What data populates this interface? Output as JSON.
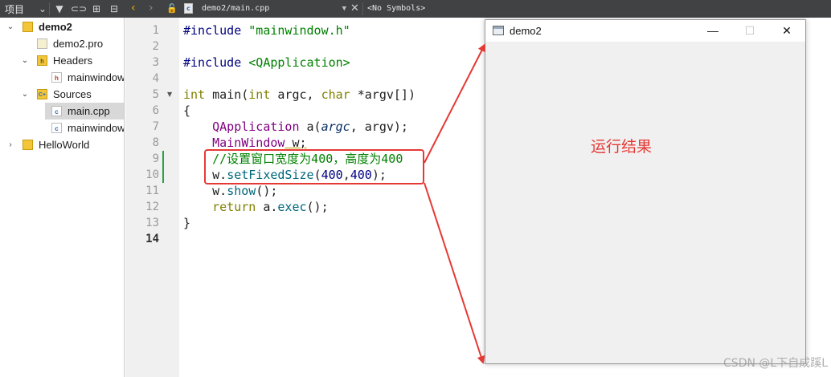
{
  "project_pane": {
    "title": "项目",
    "toolbar_icons": [
      "filter-icon",
      "link-icon",
      "split-icon",
      "close-pane-icon"
    ]
  },
  "editor_toolbar": {
    "file_combo": "demo2/main.cpp",
    "symbols_combo": "<No Symbols>",
    "icons": [
      "back-arrow-icon",
      "forward-arrow-icon",
      "lock-icon",
      "cpp-file-icon",
      "close-document-icon"
    ]
  },
  "tree": {
    "items": [
      {
        "label": "demo2",
        "bold": true
      },
      {
        "label": "demo2.pro"
      },
      {
        "label": "Headers"
      },
      {
        "label": "mainwindow.h"
      },
      {
        "label": "Sources"
      },
      {
        "label": "main.cpp"
      },
      {
        "label": "mainwindow.cpp"
      },
      {
        "label": "HelloWorld"
      }
    ],
    "display": [
      "demo2",
      "demo2.pro",
      "Headers",
      "mainwindow",
      "Sources",
      "main.cpp",
      "mainwindow",
      "HelloWorld"
    ],
    "selected": "main.cpp"
  },
  "editor": {
    "line_numbers": [
      "1",
      "2",
      "3",
      "4",
      "5",
      "6",
      "7",
      "8",
      "9",
      "10",
      "11",
      "12",
      "13",
      "14"
    ],
    "current_line": "14",
    "code": {
      "l1_a": "#include ",
      "l1_b": "\"mainwindow.h\"",
      "l3_a": "#include ",
      "l3_b": "<QApplication>",
      "l5_a": "int",
      "l5_b": " main(",
      "l5_c": "int",
      "l5_d": " argc, ",
      "l5_e": "char",
      "l5_f": " *argv[])",
      "l6": "{",
      "l7_a": "    ",
      "l7_b": "QApplication",
      "l7_c": " a(",
      "l7_d": "argc",
      "l7_e": ", argv);",
      "l8_a": "    ",
      "l8_b": "MainWindow",
      "l8_c": " w;",
      "l9_a": "    ",
      "l9_b": "//设置窗口宽度为400，高度为400",
      "l10_a": "    w.",
      "l10_b": "setFixedSize",
      "l10_c": "(",
      "l10_d": "400",
      "l10_e": ",",
      "l10_f": "400",
      "l10_g": ");",
      "l11_a": "    w.",
      "l11_b": "show",
      "l11_c": "();",
      "l12_a": "    ",
      "l12_b": "return",
      "l12_c": " a.",
      "l12_d": "exec",
      "l12_e": "();",
      "l13": "}"
    }
  },
  "demo_window": {
    "title": "demo2",
    "minimize": "—",
    "maximize": "☐",
    "close": "✕"
  },
  "annotation": {
    "result_label": "运行结果",
    "color": "#e53935"
  },
  "watermark": "CSDN @L下自成蹊L"
}
